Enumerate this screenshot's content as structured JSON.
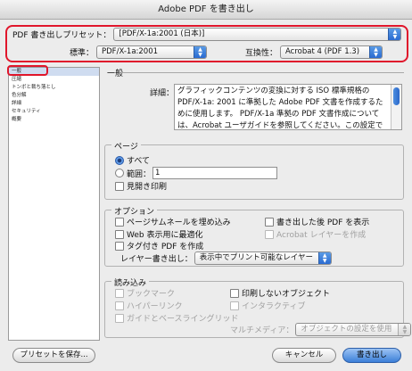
{
  "window": {
    "title": "Adobe PDF を書き出し"
  },
  "preset": {
    "label": "PDF 書き出しプリセット：",
    "value": "[PDF/X-1a:2001 (日本)]"
  },
  "standard": {
    "label": "標準：",
    "value": "PDF/X-1a:2001"
  },
  "compat": {
    "label": "互換性：",
    "value": "Acrobat 4 (PDF 1.3)"
  },
  "sidebar": {
    "items": [
      {
        "label": "一般"
      },
      {
        "label": "圧縮"
      },
      {
        "label": "トンボと裁ち落とし"
      },
      {
        "label": "色分解"
      },
      {
        "label": "詳細"
      },
      {
        "label": "セキュリティ"
      },
      {
        "label": "概要"
      }
    ]
  },
  "general": {
    "title": "一般",
    "desc_label": "詳細：",
    "description": "グラフィックコンテンツの変換に対する ISO 標準規格の PDF/X-1a: 2001 に準拠した Adobe PDF 文書を作成するために使用します。 PDF/X-1a 準拠の PDF 文書作成については、Acrobat ユーザガイドを参照してください。この設定で作成された PDF ファイルは、"
  },
  "pages": {
    "title": "ページ",
    "all": "すべて",
    "range": "範囲：",
    "range_value": "1",
    "spreads": "見開き印刷"
  },
  "options": {
    "title": "オプション",
    "embed_thumbs": "ページサムネールを埋め込み",
    "view_after": "書き出した後 PDF を表示",
    "optimize_web": "Web 表示用に最適化",
    "create_layers": "Acrobat レイヤーを作成",
    "tagged_pdf": "タグ付き PDF を作成",
    "export_layers_label": "レイヤー書き出し：",
    "export_layers_value": "表示中でプリント可能なレイヤー"
  },
  "include": {
    "title": "読み込み",
    "bookmarks": "ブックマーク",
    "nonprinting": "印刷しないオブジェクト",
    "hyperlinks": "ハイパーリンク",
    "interactive": "インタラクティブ",
    "guides": "ガイドとベースライングリッド",
    "multimedia_label": "マルチメディア：",
    "multimedia_value": "オブジェクトの設定を使用"
  },
  "buttons": {
    "save_preset": "プリセットを保存...",
    "cancel": "キャンセル",
    "export": "書き出し"
  },
  "colors": {
    "highlight": "#e0162b",
    "accent": "#3b7fd8"
  }
}
